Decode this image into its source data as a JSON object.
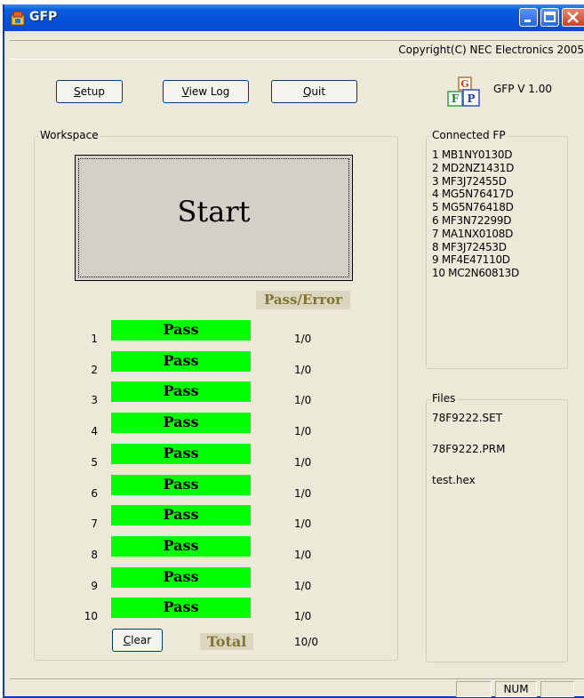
{
  "window": {
    "title": "GFP",
    "copyright": "Copyright(C) NEC Electronics 2005"
  },
  "toolbar": {
    "setup_label": "Setup",
    "setup_mnemonic": "S",
    "setup_rest": "etup",
    "viewlog_mnemonic": "V",
    "viewlog_rest": "iew Log",
    "quit_mnemonic": "Q",
    "quit_rest": "uit"
  },
  "version": "GFP V 1.00",
  "workspace": {
    "label": "Workspace",
    "start_label": "Start",
    "pass_error_header": "Pass/Error",
    "rows": [
      {
        "num": "1",
        "status": "Pass",
        "count": "1/0"
      },
      {
        "num": "2",
        "status": "Pass",
        "count": "1/0"
      },
      {
        "num": "3",
        "status": "Pass",
        "count": "1/0"
      },
      {
        "num": "4",
        "status": "Pass",
        "count": "1/0"
      },
      {
        "num": "5",
        "status": "Pass",
        "count": "1/0"
      },
      {
        "num": "6",
        "status": "Pass",
        "count": "1/0"
      },
      {
        "num": "7",
        "status": "Pass",
        "count": "1/0"
      },
      {
        "num": "8",
        "status": "Pass",
        "count": "1/0"
      },
      {
        "num": "9",
        "status": "Pass",
        "count": "1/0"
      },
      {
        "num": "10",
        "status": "Pass",
        "count": "1/0"
      }
    ],
    "clear_mnemonic": "C",
    "clear_rest": "lear",
    "total_label": "Total",
    "total_count": "10/0"
  },
  "connected_fp": {
    "label": "Connected FP",
    "items": [
      "1 MB1NY0130D",
      "2 MD2NZ1431D",
      "3 MF3J72455D",
      "4 MG5N76417D",
      "5 MG5N76418D",
      "6 MF3N72299D",
      "7 MA1NX0108D",
      "8 MF3J72453D",
      "9 MF4E47110D",
      "10 MC2N60813D"
    ]
  },
  "files": {
    "label": "Files",
    "items": [
      "78F9222.SET",
      "78F9222.PRM",
      "test.hex"
    ]
  },
  "statusbar": {
    "num_indicator": "NUM"
  },
  "colors": {
    "pass_green": "#00ff00",
    "header_gold": "#807530",
    "title_blue": "#0450d8"
  }
}
